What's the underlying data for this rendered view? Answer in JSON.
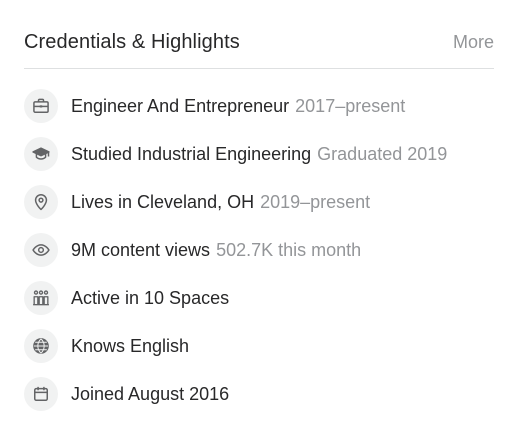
{
  "header": {
    "title": "Credentials & Highlights",
    "more_label": "More"
  },
  "items": [
    {
      "icon": "briefcase-icon",
      "primary": "Engineer And Entrepreneur",
      "secondary": "2017–present"
    },
    {
      "icon": "graduation-cap-icon",
      "primary": "Studied Industrial Engineering",
      "secondary": "Graduated 2019"
    },
    {
      "icon": "location-pin-icon",
      "primary": "Lives in Cleveland, OH",
      "secondary": "2019–present"
    },
    {
      "icon": "eye-icon",
      "primary": "9M content views",
      "secondary": "502.7K this month"
    },
    {
      "icon": "spaces-icon",
      "primary": "Active in 10 Spaces",
      "secondary": ""
    },
    {
      "icon": "globe-icon",
      "primary": "Knows English",
      "secondary": ""
    },
    {
      "icon": "calendar-icon",
      "primary": "Joined August 2016",
      "secondary": ""
    }
  ],
  "colors": {
    "text": "#282829",
    "muted": "#939598",
    "icon_bg": "#f1f2f2",
    "divider": "#dee0e1"
  }
}
